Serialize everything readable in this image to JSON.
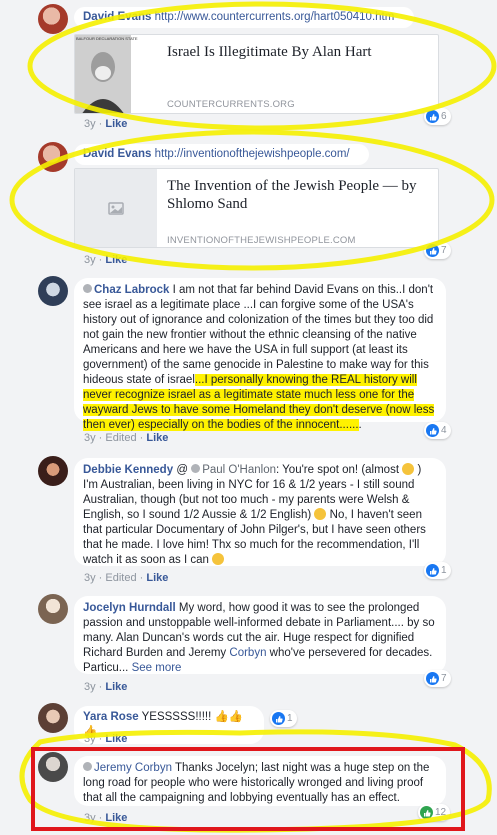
{
  "comments": [
    {
      "author": "David Evans",
      "text": "http://www.countercurrents.org/hart050410.htm",
      "preview": {
        "thumb_caption": "BALFOUR DECLARATION STATE",
        "title": "Israel Is Illegitimate By Alan Hart",
        "domain": "COUNTERCURRENTS.ORG"
      },
      "time": "3y",
      "actions": [
        "Like"
      ],
      "reactions": "6"
    },
    {
      "author": "David Evans",
      "text": "http://inventionofthejewishpeople.com/",
      "preview": {
        "title": "The Invention of the Jewish People — by Shlomo Sand",
        "domain": "INVENTIONOFTHEJEWISHPEOPLE.COM"
      },
      "time": "3y",
      "actions": [
        "Like"
      ],
      "reactions": "7"
    },
    {
      "author": "Chaz Labrock",
      "text_plain": "I am not that far behind David Evans on this..I don't see israel as a legitimate place ...I can forgive some of the USA's history out of ignorance and colonization of the times but they too did not gain the new frontier without the ethnic cleansing of the native Americans and here we have the USA in full support (at least its government) of the same genocide in Palestine to make way for this hideous state of israel",
      "text_highlight": "...I personally knowing the REAL history will never recognize israel as a legitimate state much less one for the wayward Jews to have some Homeland they don't deserve (now less then ever) especially on the bodies of the innocent......",
      "text_tail": ".",
      "time": "3y",
      "edited": "Edited",
      "actions": [
        "Like"
      ],
      "reactions": "4"
    },
    {
      "author": "Debbie Kennedy",
      "at": "@",
      "mention": "Paul O'Hanlon",
      "text_a": ": You're spot on! (almost",
      "text_b": ") I'm Australian, been living in NYC for 16 & 1/2 years - I still sound Australian, though (but not too much - my parents were Welsh & English, so I sound 1/2 Aussie & 1/2 English)",
      "text_c": "No, I haven't seen that particular Documentary of John Pilger's, but I have seen others that he made. I love him! Thx so much for the recommendation, I'll watch it as soon as I can",
      "time": "3y",
      "edited": "Edited",
      "actions": [
        "Like"
      ],
      "reactions": "1"
    },
    {
      "author": "Jocelyn Hurndall",
      "text_a": "My word, how good it was to see the prolonged passion and unstoppable well-informed debate in Parliament.... by so many. Alan Duncan's words cut the air. Huge respect for dignified Richard Burden and Jeremy",
      "mention": "Corbyn",
      "text_b": "who've persevered for decades. Particu...",
      "see_more": "See more",
      "time": "3y",
      "actions": [
        "Like"
      ],
      "reactions": "7"
    },
    {
      "author": "Yara Rose",
      "text": "YESSSSS!!!!!",
      "time": "3y",
      "actions": [
        "Like"
      ],
      "reactions": "1"
    },
    {
      "author_first": "Jeremy",
      "author_last": "Corbyn",
      "text": "Thanks Jocelyn; last night was a huge step on the long road for people who were historically wronged and living proof that all the campaigning and lobbying eventually has an effect.",
      "time": "3y",
      "actions": [
        "Like"
      ],
      "reactions": "12"
    }
  ],
  "colors": {
    "highlight_yellow": "#fff200",
    "annotation_red": "#e0161b",
    "link_blue": "#385898",
    "like_blue": "#1877f2"
  }
}
